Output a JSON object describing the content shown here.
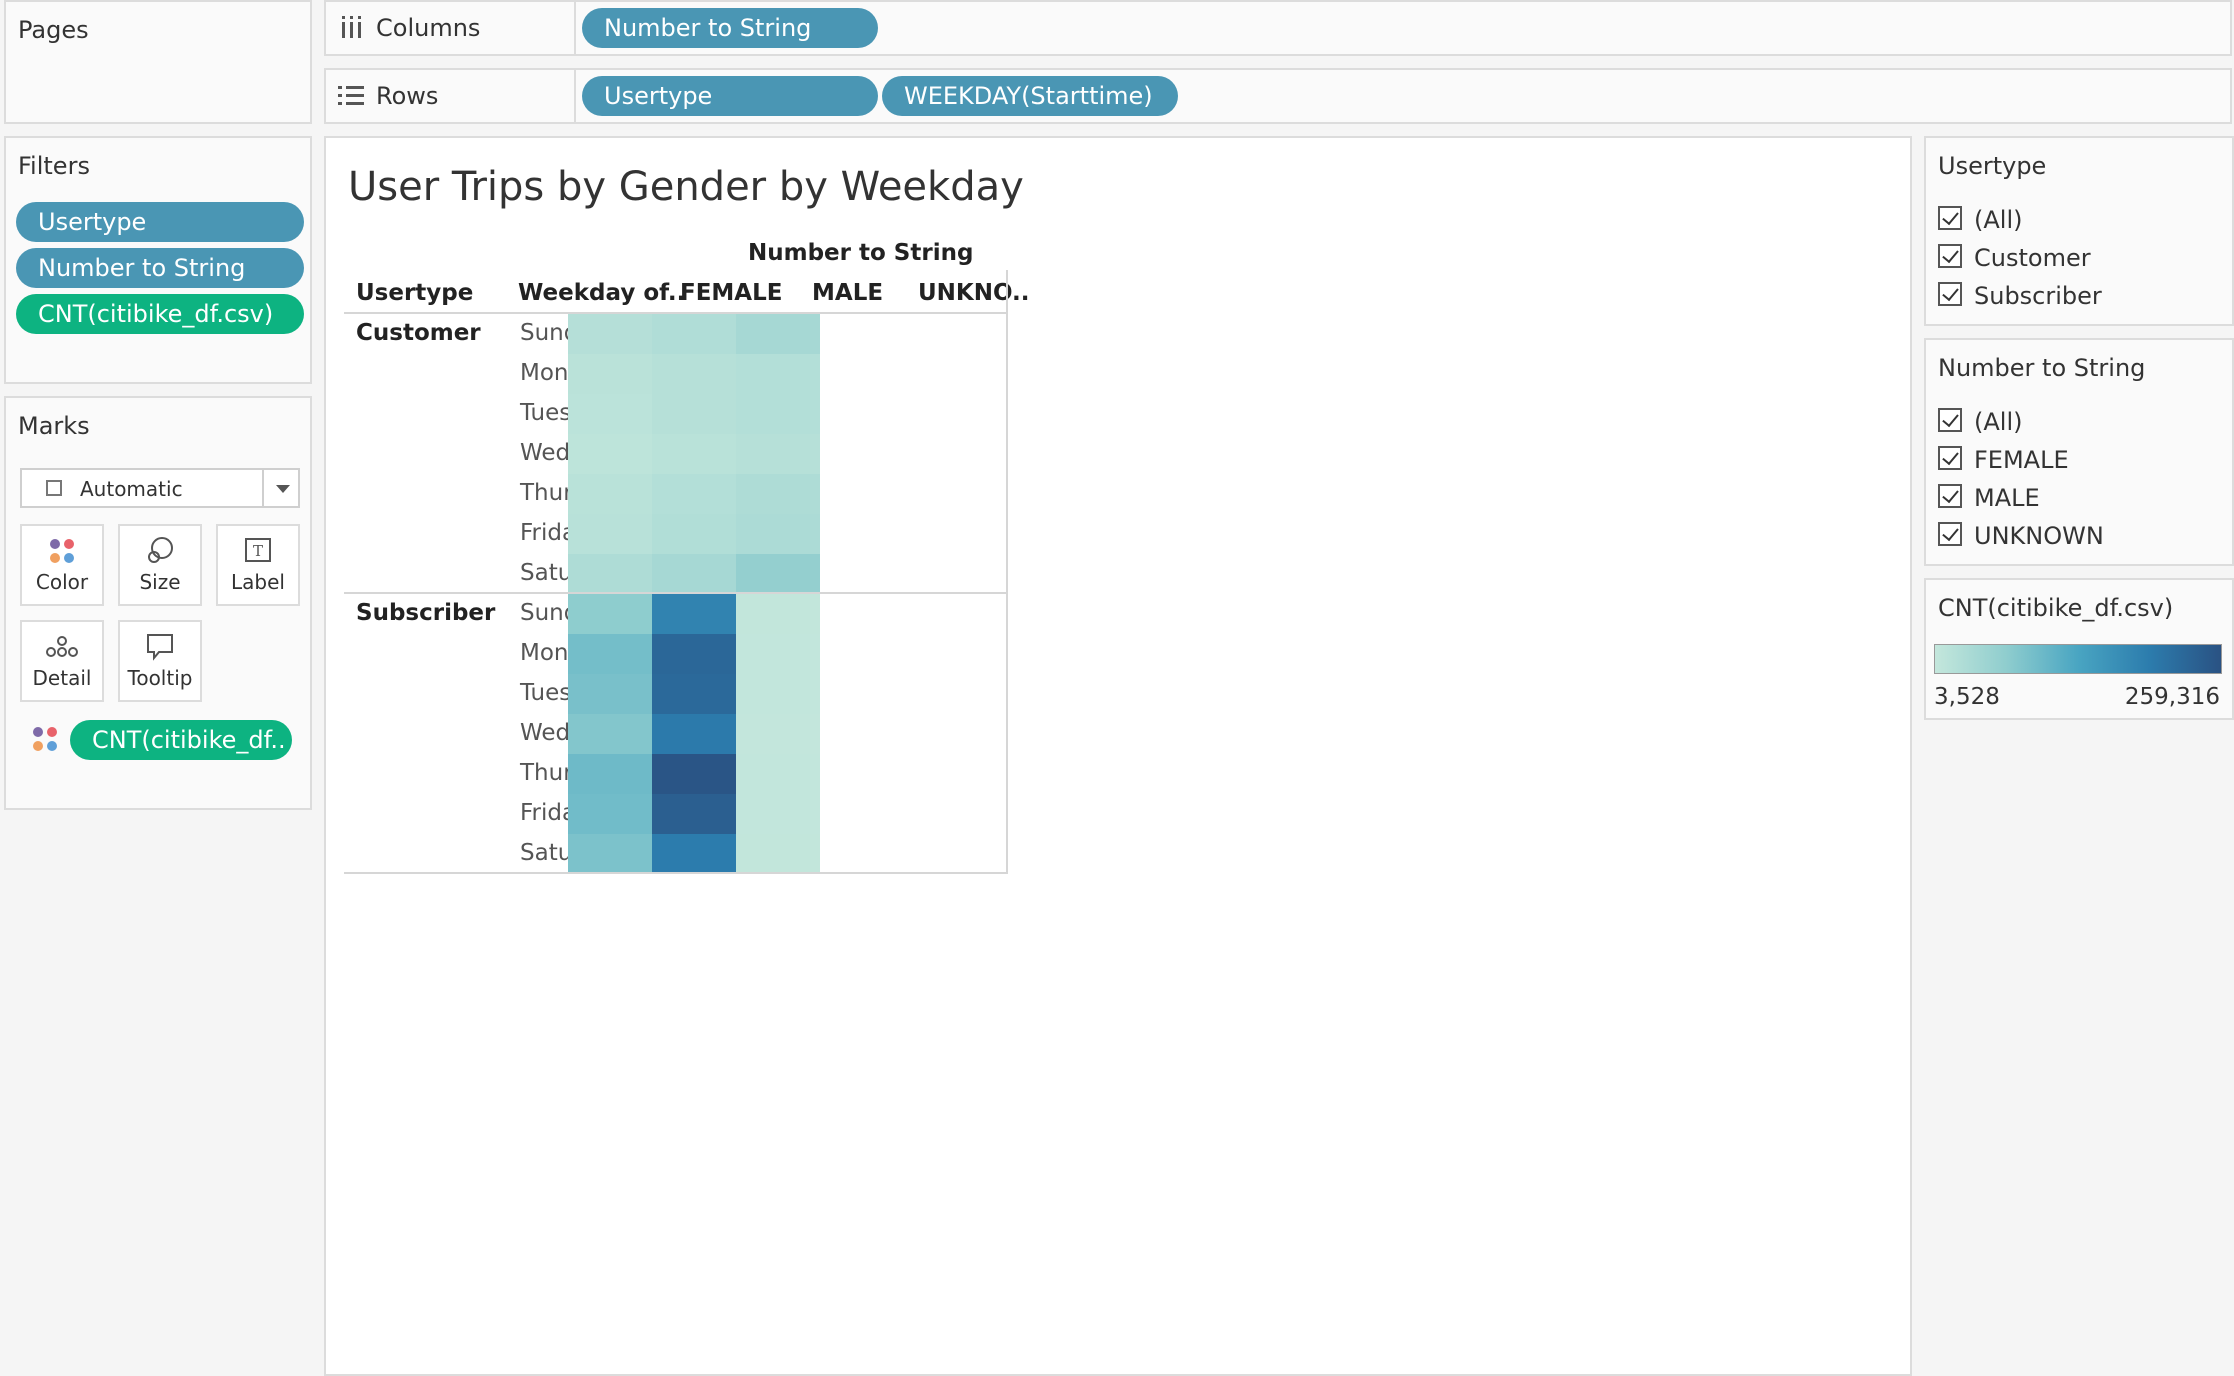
{
  "pages": {
    "title": "Pages"
  },
  "columns_shelf": {
    "label": "Columns",
    "pills": [
      "Number to String"
    ]
  },
  "rows_shelf": {
    "label": "Rows",
    "pills": [
      "Usertype",
      "WEEKDAY(Starttime)"
    ]
  },
  "filters": {
    "title": "Filters",
    "pills": [
      "Usertype",
      "Number to String",
      "CNT(citibike_df.csv)"
    ]
  },
  "marks": {
    "title": "Marks",
    "type": "Automatic",
    "buttons": [
      "Color",
      "Size",
      "Label",
      "Detail",
      "Tooltip"
    ],
    "color_pill": "CNT(citibike_df.."
  },
  "view": {
    "title": "User Trips by Gender by Weekday",
    "column_header": "Number to String",
    "row_headers": [
      "Usertype",
      "Weekday of.."
    ],
    "columns": [
      "FEMALE",
      "MALE",
      "UNKNO.."
    ],
    "groups": [
      {
        "name": "Customer",
        "days": [
          "Sunday",
          "Monday",
          "Tuesday",
          "Wednesday",
          "Thursday",
          "Friday",
          "Saturday"
        ]
      },
      {
        "name": "Subscriber",
        "days": [
          "Sunday",
          "Monday",
          "Tuesday",
          "Wednesday",
          "Thursday",
          "Friday",
          "Saturday"
        ]
      }
    ]
  },
  "chart_data": {
    "type": "heatmap",
    "title": "User Trips by Gender by Weekday",
    "x_title": "Number to String",
    "x": [
      "FEMALE",
      "MALE",
      "UNKNO.."
    ],
    "y_groups": [
      "Customer",
      "Subscriber"
    ],
    "y": [
      "Sunday",
      "Monday",
      "Tuesday",
      "Wednesday",
      "Thursday",
      "Friday",
      "Saturday"
    ],
    "measure": "CNT(citibike_df.csv)",
    "range": [
      3528,
      259316
    ],
    "colors": [
      "#c4e7dc",
      "#8fcdce",
      "#49a5c2",
      "#2c7cad",
      "#2a5283"
    ],
    "values": {
      "Customer": [
        [
          22000,
          28000,
          40000
        ],
        [
          15000,
          20000,
          24000
        ],
        [
          14000,
          21000,
          24000
        ],
        [
          12000,
          17000,
          20000
        ],
        [
          17000,
          24000,
          30000
        ],
        [
          18000,
          26000,
          32000
        ],
        [
          30000,
          40000,
          62000
        ]
      ],
      "Subscriber": [
        [
          68000,
          185000,
          6000
        ],
        [
          92000,
          228000,
          5500
        ],
        [
          88000,
          225000,
          5800
        ],
        [
          78000,
          198000,
          5200
        ],
        [
          98000,
          255000,
          5600
        ],
        [
          95000,
          240000,
          5400
        ],
        [
          85000,
          196000,
          6500
        ]
      ]
    }
  },
  "legends": {
    "usertype": {
      "title": "Usertype",
      "items": [
        "(All)",
        "Customer",
        "Subscriber"
      ]
    },
    "number_to_string": {
      "title": "Number to String",
      "items": [
        "(All)",
        "FEMALE",
        "MALE",
        "UNKNOWN"
      ]
    },
    "color": {
      "title": "CNT(citibike_df.csv)",
      "min_label": "3,528",
      "max_label": "259,316"
    }
  }
}
